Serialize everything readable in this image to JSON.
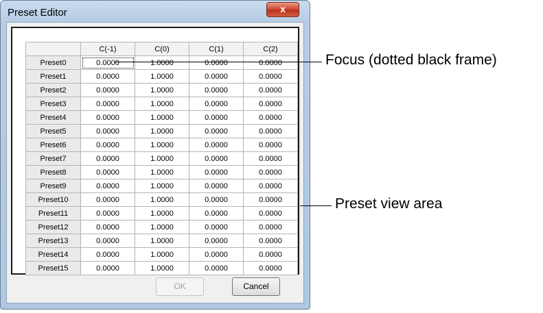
{
  "window": {
    "title": "Preset Editor",
    "close_label": "x"
  },
  "table": {
    "columns": [
      "C(-1)",
      "C(0)",
      "C(1)",
      "C(2)"
    ],
    "rows": [
      {
        "label": "Preset0",
        "values": [
          "0.0000",
          "1.0000",
          "0.0000",
          "0.0000"
        ]
      },
      {
        "label": "Preset1",
        "values": [
          "0.0000",
          "1.0000",
          "0.0000",
          "0.0000"
        ]
      },
      {
        "label": "Preset2",
        "values": [
          "0.0000",
          "1.0000",
          "0.0000",
          "0.0000"
        ]
      },
      {
        "label": "Preset3",
        "values": [
          "0.0000",
          "1.0000",
          "0.0000",
          "0.0000"
        ]
      },
      {
        "label": "Preset4",
        "values": [
          "0.0000",
          "1.0000",
          "0.0000",
          "0.0000"
        ]
      },
      {
        "label": "Preset5",
        "values": [
          "0.0000",
          "1.0000",
          "0.0000",
          "0.0000"
        ]
      },
      {
        "label": "Preset6",
        "values": [
          "0.0000",
          "1.0000",
          "0.0000",
          "0.0000"
        ]
      },
      {
        "label": "Preset7",
        "values": [
          "0.0000",
          "1.0000",
          "0.0000",
          "0.0000"
        ]
      },
      {
        "label": "Preset8",
        "values": [
          "0.0000",
          "1.0000",
          "0.0000",
          "0.0000"
        ]
      },
      {
        "label": "Preset9",
        "values": [
          "0.0000",
          "1.0000",
          "0.0000",
          "0.0000"
        ]
      },
      {
        "label": "Preset10",
        "values": [
          "0.0000",
          "1.0000",
          "0.0000",
          "0.0000"
        ]
      },
      {
        "label": "Preset11",
        "values": [
          "0.0000",
          "1.0000",
          "0.0000",
          "0.0000"
        ]
      },
      {
        "label": "Preset12",
        "values": [
          "0.0000",
          "1.0000",
          "0.0000",
          "0.0000"
        ]
      },
      {
        "label": "Preset13",
        "values": [
          "0.0000",
          "1.0000",
          "0.0000",
          "0.0000"
        ]
      },
      {
        "label": "Preset14",
        "values": [
          "0.0000",
          "1.0000",
          "0.0000",
          "0.0000"
        ]
      },
      {
        "label": "Preset15",
        "values": [
          "0.0000",
          "1.0000",
          "0.0000",
          "0.0000"
        ]
      }
    ]
  },
  "buttons": {
    "ok_label": "OK",
    "cancel_label": "Cancel"
  },
  "annotations": {
    "focus": "Focus (dotted black frame)",
    "view_area": "Preset view area"
  }
}
